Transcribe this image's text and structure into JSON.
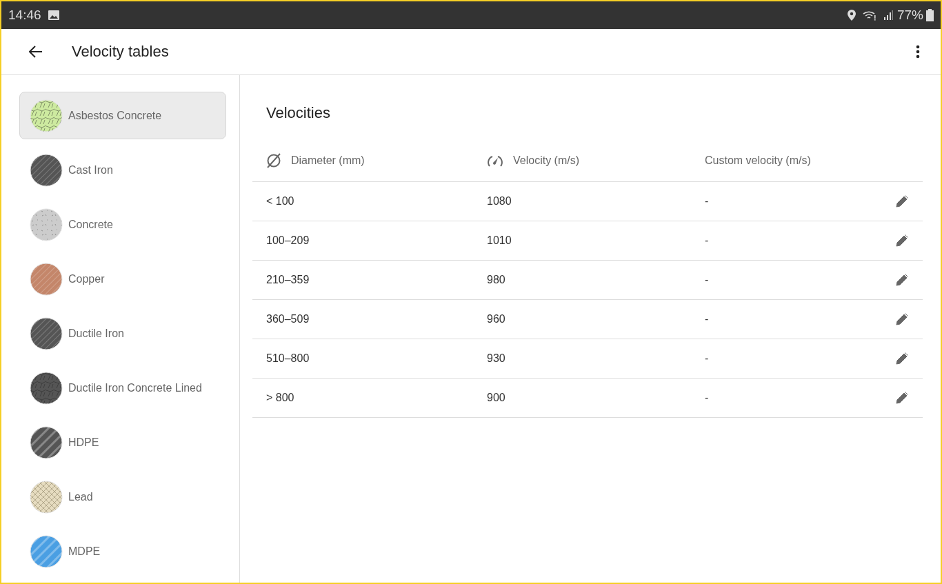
{
  "status_bar": {
    "time": "14:46",
    "battery": "77%"
  },
  "app_bar": {
    "title": "Velocity tables"
  },
  "sidebar": {
    "items": [
      {
        "label": "Asbestos Concrete",
        "selected": true,
        "color": "#cdeaa0",
        "kind": "cracked"
      },
      {
        "label": "Cast Iron",
        "selected": false,
        "color": "#555555",
        "kind": "stripes"
      },
      {
        "label": "Concrete",
        "selected": false,
        "color": "#cccccc",
        "kind": "speckled"
      },
      {
        "label": "Copper",
        "selected": false,
        "color": "#c4866a",
        "kind": "stripes"
      },
      {
        "label": "Ductile Iron",
        "selected": false,
        "color": "#555555",
        "kind": "stripes"
      },
      {
        "label": "Ductile Iron Concrete Lined",
        "selected": false,
        "color": "#555555",
        "kind": "cracked"
      },
      {
        "label": "HDPE",
        "selected": false,
        "color": "#555555",
        "kind": "bands"
      },
      {
        "label": "Lead",
        "selected": false,
        "color": "#e6dcc0",
        "kind": "crosshatch"
      },
      {
        "label": "MDPE",
        "selected": false,
        "color": "#4a9fe3",
        "kind": "bands"
      }
    ]
  },
  "content": {
    "title": "Velocities",
    "table": {
      "columns": [
        "Diameter (mm)",
        "Velocity (m/s)",
        "Custom velocity (m/s)"
      ],
      "rows": [
        [
          "< 100",
          "1080",
          "-"
        ],
        [
          "100–209",
          "1010",
          "-"
        ],
        [
          "210–359",
          "980",
          "-"
        ],
        [
          "360–509",
          "960",
          "-"
        ],
        [
          "510–800",
          "930",
          "-"
        ],
        [
          "> 800",
          "900",
          "-"
        ]
      ]
    }
  }
}
